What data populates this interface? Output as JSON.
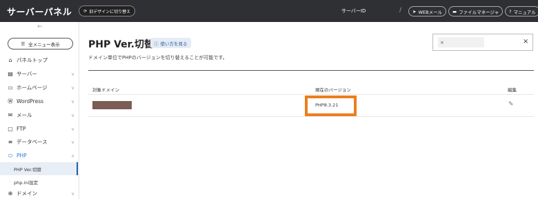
{
  "header": {
    "brand": "サーバーパネル",
    "old_design_label": "旧デザインに切り替え",
    "server_id_label": "サーバーID",
    "separator": "/",
    "buttons": [
      {
        "label": "WEBメール",
        "icon": "send-icon"
      },
      {
        "label": "ファイルマネージャ",
        "icon": "folder-icon"
      },
      {
        "label": "マニュアル",
        "icon": "help-icon"
      }
    ]
  },
  "sidebar": {
    "collapse_icon": "arrow-left-icon",
    "all_menu_label": "全メニュー表示",
    "items": [
      {
        "label": "パネルトップ",
        "icon": "home-icon"
      },
      {
        "label": "サーバー",
        "icon": "server-icon"
      },
      {
        "label": "ホームページ",
        "icon": "window-icon"
      },
      {
        "label": "WordPress",
        "icon": "wordpress-icon"
      },
      {
        "label": "メール",
        "icon": "mail-icon"
      },
      {
        "label": "FTP",
        "icon": "monitor-icon"
      },
      {
        "label": "データベース",
        "icon": "database-icon"
      },
      {
        "label": "PHP",
        "icon": "php-icon"
      },
      {
        "label": "ドメイン",
        "icon": "globe-icon"
      }
    ],
    "php_sub_items": [
      {
        "label": "PHP Ver.切替"
      },
      {
        "label": "php.ini設定"
      }
    ]
  },
  "main": {
    "title": "PHP Ver.切替",
    "howto_label": "使い方を見る",
    "description": "ドメイン単位でPHPのバージョンを切り替えることが可能です。",
    "search": {
      "value": "×",
      "close": "×"
    },
    "table": {
      "headers": {
        "domain": "対象ドメイン",
        "version": "現在のバージョン",
        "edit": "編集"
      },
      "rows": [
        {
          "domain": "",
          "version": "PHP8.3.21"
        }
      ]
    },
    "highlight_color": "#EE7D1C"
  }
}
